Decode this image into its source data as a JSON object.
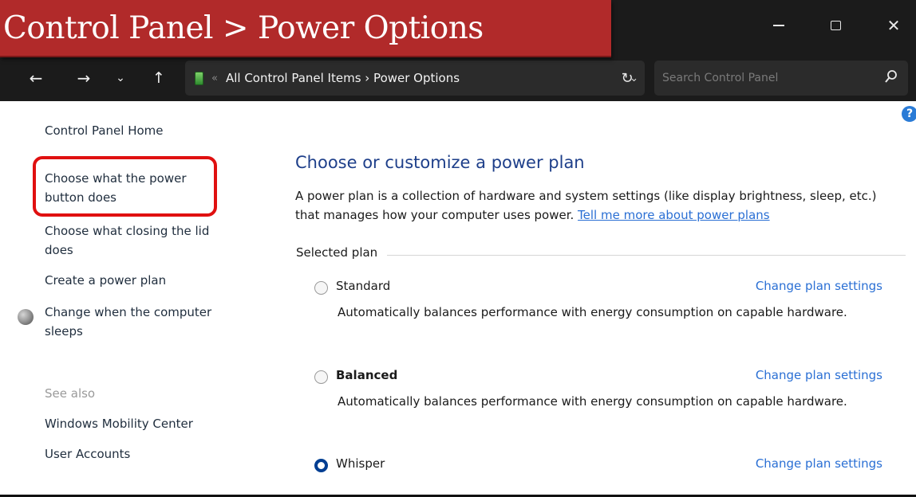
{
  "banner": {
    "text": "Control Panel > Power Options"
  },
  "window": {
    "minimize_icon": "minimize-icon",
    "maximize_icon": "maximize-icon",
    "close_glyph": "✕"
  },
  "nav": {
    "back_glyph": "←",
    "forward_glyph": "→",
    "recent_glyph": "⌄",
    "up_glyph": "↑",
    "address_sep": "«",
    "address_text": "All Control Panel Items  ›  Power Options",
    "address_chevron": "⌄",
    "refresh_glyph": "↻",
    "search_placeholder": "Search Control Panel"
  },
  "sidebar": {
    "home": "Control Panel Home",
    "items": [
      {
        "label_lines": [
          "Choose what the power",
          "button does"
        ]
      },
      {
        "label_lines": [
          "Choose what closing the lid",
          "does"
        ]
      },
      {
        "label_lines": [
          "Create a power plan"
        ]
      },
      {
        "label_lines": [
          "Change when the computer",
          "sleeps"
        ]
      }
    ],
    "see_also": "See also",
    "see_also_items": [
      "Windows Mobility Center",
      "User Accounts"
    ]
  },
  "main": {
    "title": "Choose or customize a power plan",
    "intro": "A power plan is a collection of hardware and system settings (like display brightness, sleep, etc.) that manages how your computer uses power. ",
    "intro_link": "Tell me more about power plans",
    "selected_plan_label": "Selected plan",
    "change_label": "Change plan settings",
    "plans": [
      {
        "name": "Standard",
        "description": "Automatically balances performance with energy consumption on capable hardware.",
        "selected": false
      },
      {
        "name": "Balanced",
        "description": "Automatically balances performance with energy consumption on capable hardware.",
        "selected": false
      },
      {
        "name": "Whisper",
        "description": "",
        "selected": true
      }
    ]
  },
  "help": {
    "glyph": "?"
  },
  "colors": {
    "banner_bg": "#b12a2a",
    "titlebar_bg": "#1b1b1b",
    "link": "#2a6fd4",
    "heading": "#1e3f8a",
    "highlight": "#e01010",
    "radio_selected": "#003e92"
  }
}
